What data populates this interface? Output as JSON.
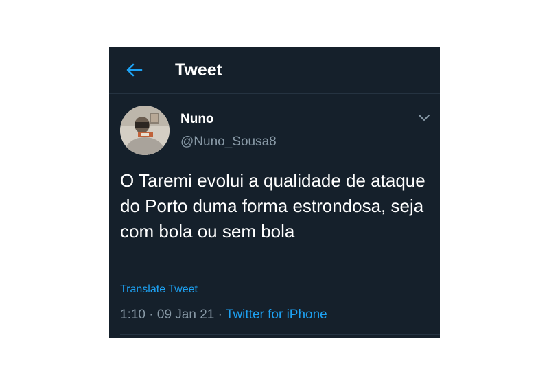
{
  "header": {
    "back_icon": "arrow-left-icon",
    "title": "Tweet"
  },
  "tweet": {
    "author": {
      "name": "Nuno",
      "handle": "@Nuno_Sousa8",
      "avatar_icon": "profile-photo"
    },
    "more_icon": "chevron-down-icon",
    "text": "O Taremi evolui a qualidade de ataque do Porto duma forma estrondosa, seja com bola ou sem bola",
    "translate_label": "Translate Tweet",
    "time": "1:10",
    "separator": "·",
    "date": "09 Jan 21",
    "source": "Twitter for iPhone"
  },
  "colors": {
    "background": "#15202b",
    "text": "#ffffff",
    "secondary_text": "#8899a6",
    "accent": "#1da1f2",
    "divider": "#253341"
  }
}
